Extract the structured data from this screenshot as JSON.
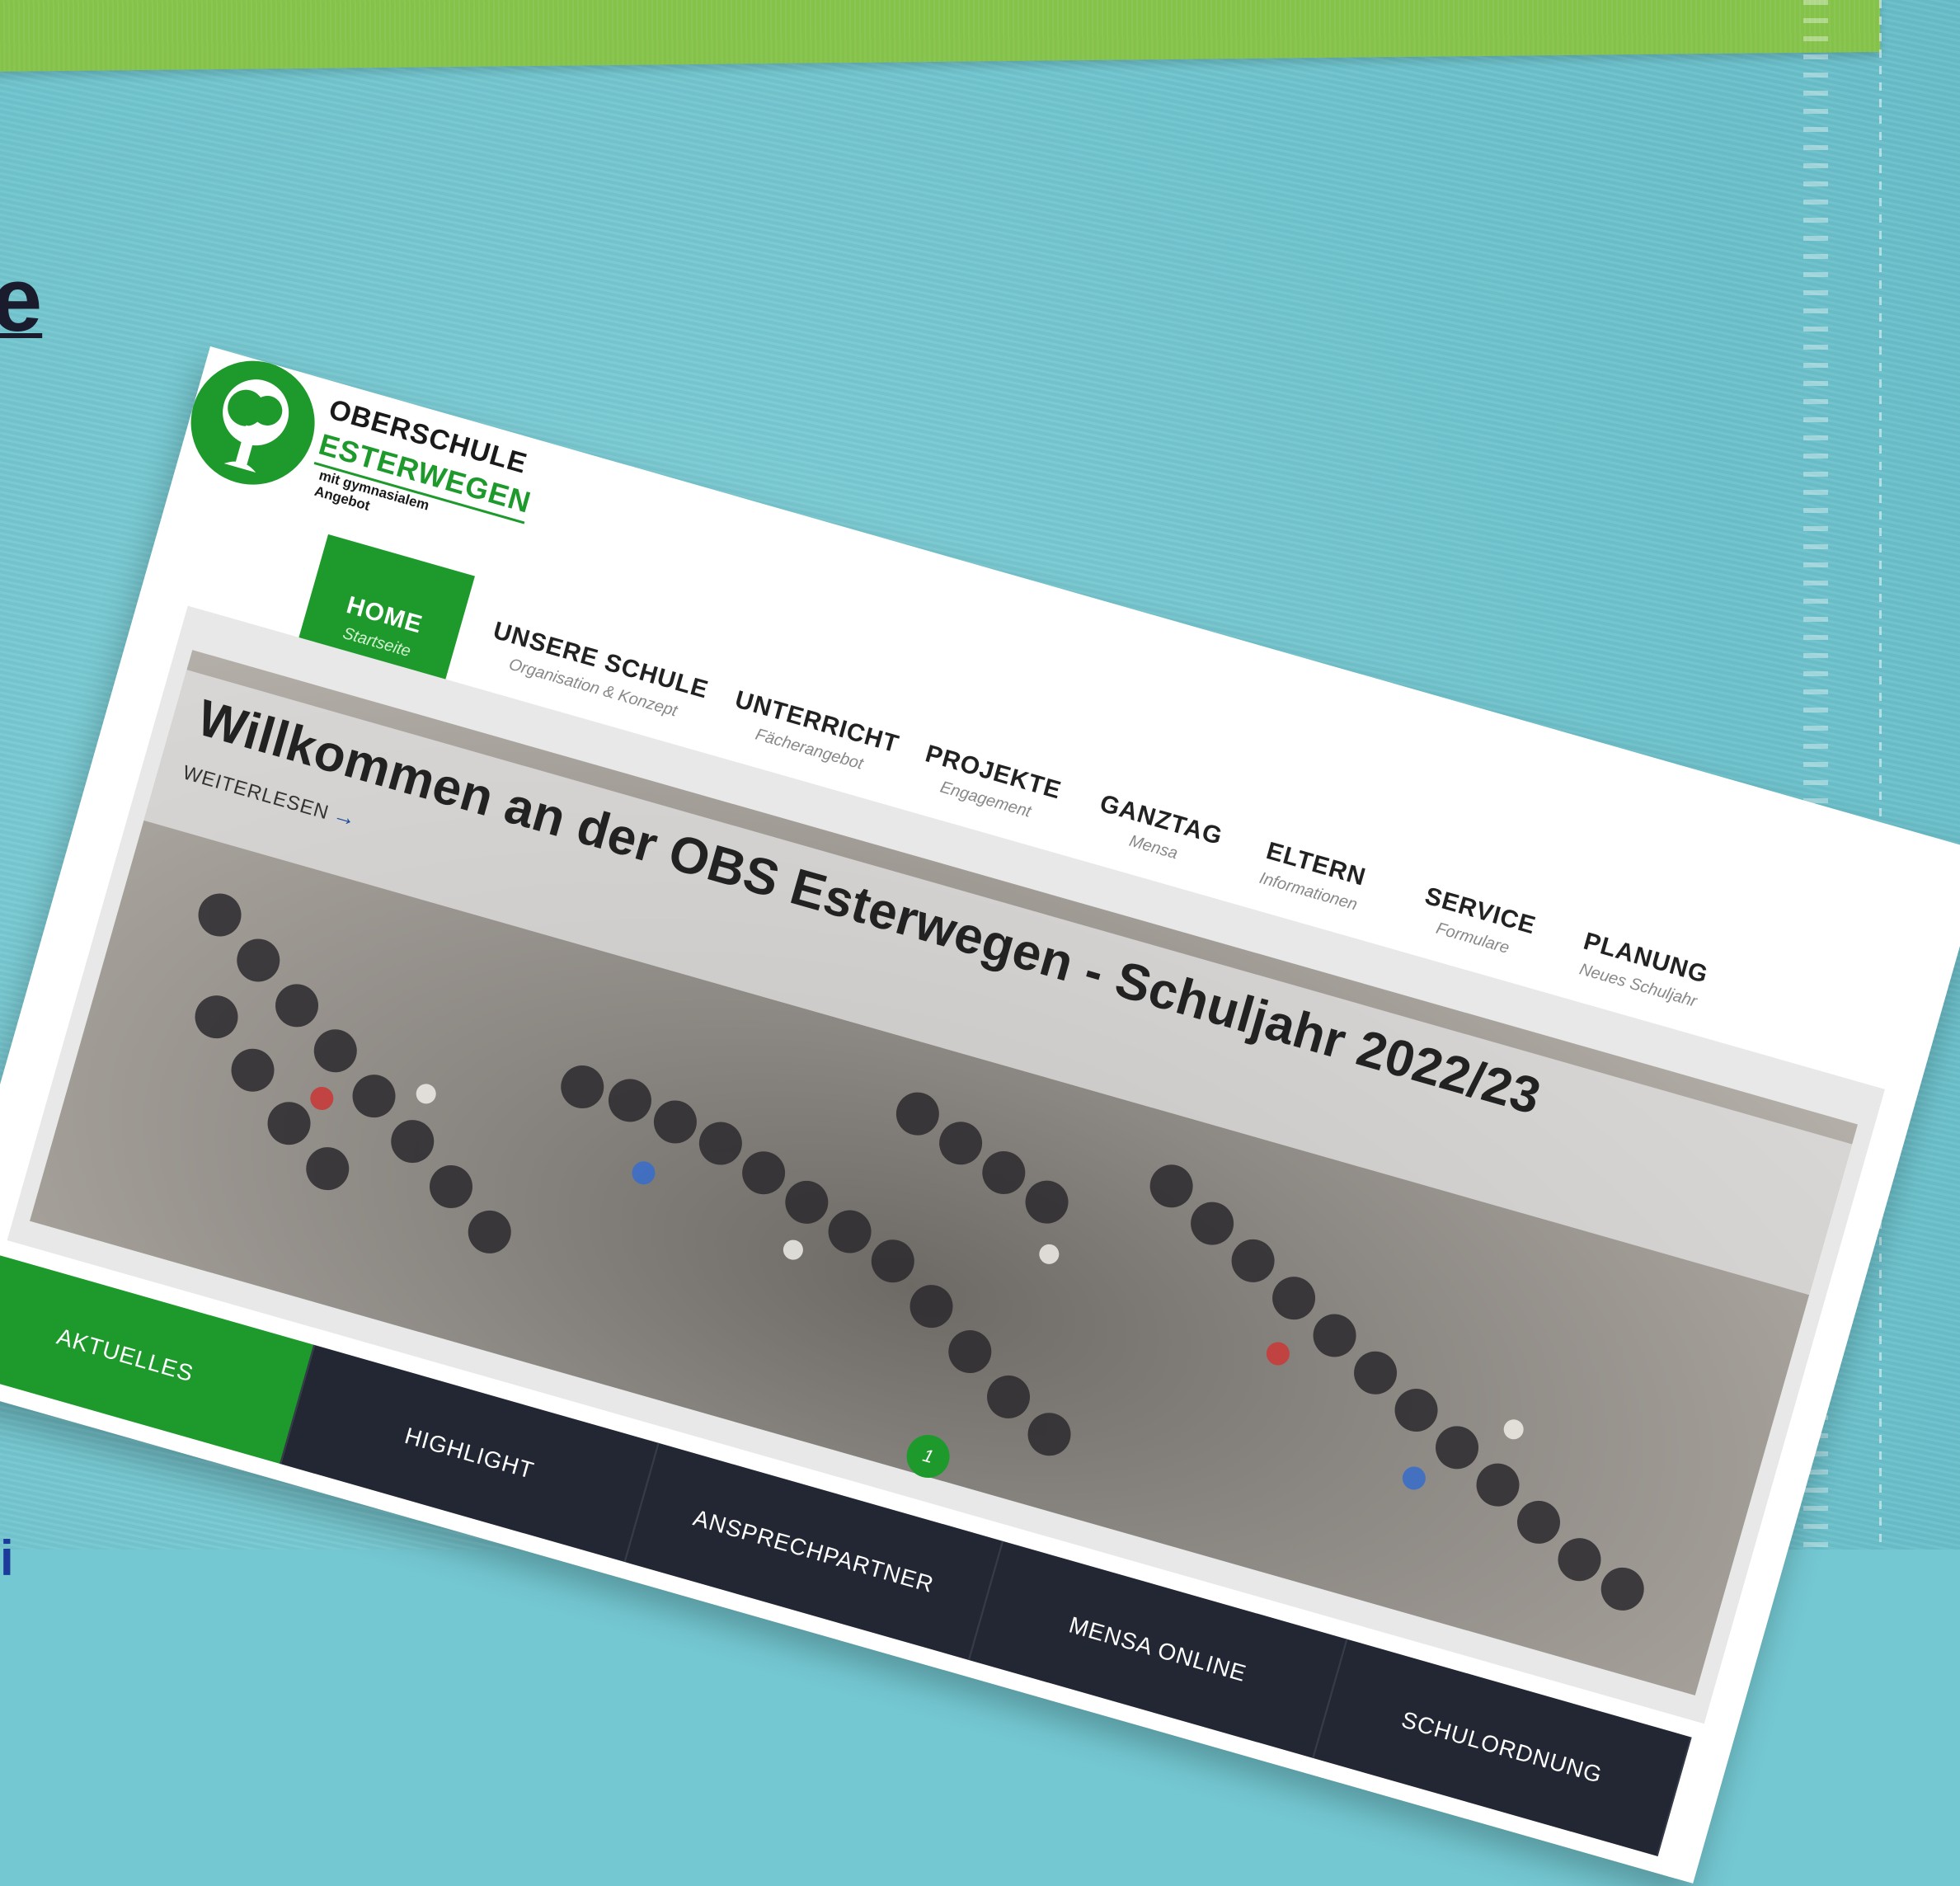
{
  "background": {
    "edge_letter": "e",
    "edge_bottom_mark": "i"
  },
  "colors": {
    "brand_green": "#1e9a2c",
    "tab_dark": "#222733",
    "backdrop_teal": "#74c8d2"
  },
  "logo": {
    "icon": "tree-logo-icon",
    "line1": "OBERSCHULE",
    "line2": "ESTERWEGEN",
    "line3": "mit gymnasialem Angebot"
  },
  "nav": {
    "items": [
      {
        "label": "HOME",
        "sub": "Startseite",
        "active": true
      },
      {
        "label": "UNSERE SCHULE",
        "sub": "Organisation & Konzept"
      },
      {
        "label": "UNTERRICHT",
        "sub": "Fächerangebot"
      },
      {
        "label": "PROJEKTE",
        "sub": "Engagement"
      },
      {
        "label": "GANZTAG",
        "sub": "Mensa"
      },
      {
        "label": "ELTERN",
        "sub": "Informationen"
      },
      {
        "label": "SERVICE",
        "sub": "Formulare"
      },
      {
        "label": "PLANUNG",
        "sub": "Neues Schuljahr"
      }
    ]
  },
  "hero": {
    "title": "Willkommen an der OBS Esterwegen - Schuljahr 2022/23",
    "read_more": "WEITERLESEN",
    "arrow_icon": "arrow-right-icon",
    "page_indicator": "1"
  },
  "tabs": [
    {
      "label": "AKTUELLES",
      "active": true
    },
    {
      "label": "HIGHLIGHT"
    },
    {
      "label": "ANSPRECHPARTNER"
    },
    {
      "label": "MENSA ONLINE"
    },
    {
      "label": "SCHULORDNUNG"
    }
  ]
}
